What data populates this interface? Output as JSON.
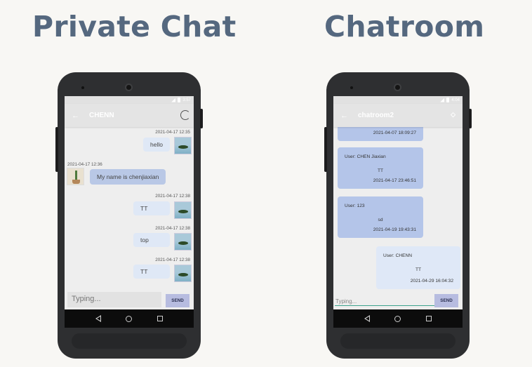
{
  "headings": {
    "left": "Private Chat",
    "right": "Chatroom"
  },
  "private_chat": {
    "status_time": "3:57",
    "title": "CHENN",
    "messages": [
      {
        "side": "me",
        "time": "2021-04-17 12:35",
        "text": "hello"
      },
      {
        "side": "other",
        "time": "2021-04-17 12:36",
        "text": "My name is chenjiaxian"
      },
      {
        "side": "me",
        "time": "2021-04-17 12:38",
        "text": "TT"
      },
      {
        "side": "me",
        "time": "2021-04-17 12:38",
        "text": "top"
      },
      {
        "side": "me",
        "time": "2021-04-17 12:38",
        "text": "TT"
      }
    ],
    "input_placeholder": "Typing...",
    "send_label": "SEND"
  },
  "chatroom": {
    "status_time": "4:04",
    "title": "chatroom2",
    "messages": [
      {
        "user": "",
        "text": "",
        "time": "2021-04-07 18:09:27"
      },
      {
        "user": "User: CHEN Jiaxian",
        "text": "TT",
        "time": "2021-04-17 23:46:51"
      },
      {
        "user": "User: 123",
        "text": "sd",
        "time": "2021-04-19 19:43:31"
      },
      {
        "user": "User: CHENN",
        "text": "TT",
        "time": "2021-04-29  16:04:32"
      }
    ],
    "input_placeholder": "Typing...",
    "send_label": "SEND"
  },
  "colors": {
    "heading": "#55687f",
    "bubble_me": "#dfe8f6",
    "bubble_other": "#b9c8e6",
    "send_button": "#b7bce0",
    "input_underline": "#3da48d"
  },
  "icons": [
    "back-arrow-icon",
    "refresh-icon",
    "more-icon",
    "nav-back-icon",
    "nav-home-icon",
    "nav-recent-icon",
    "signal-icon",
    "battery-icon"
  ]
}
